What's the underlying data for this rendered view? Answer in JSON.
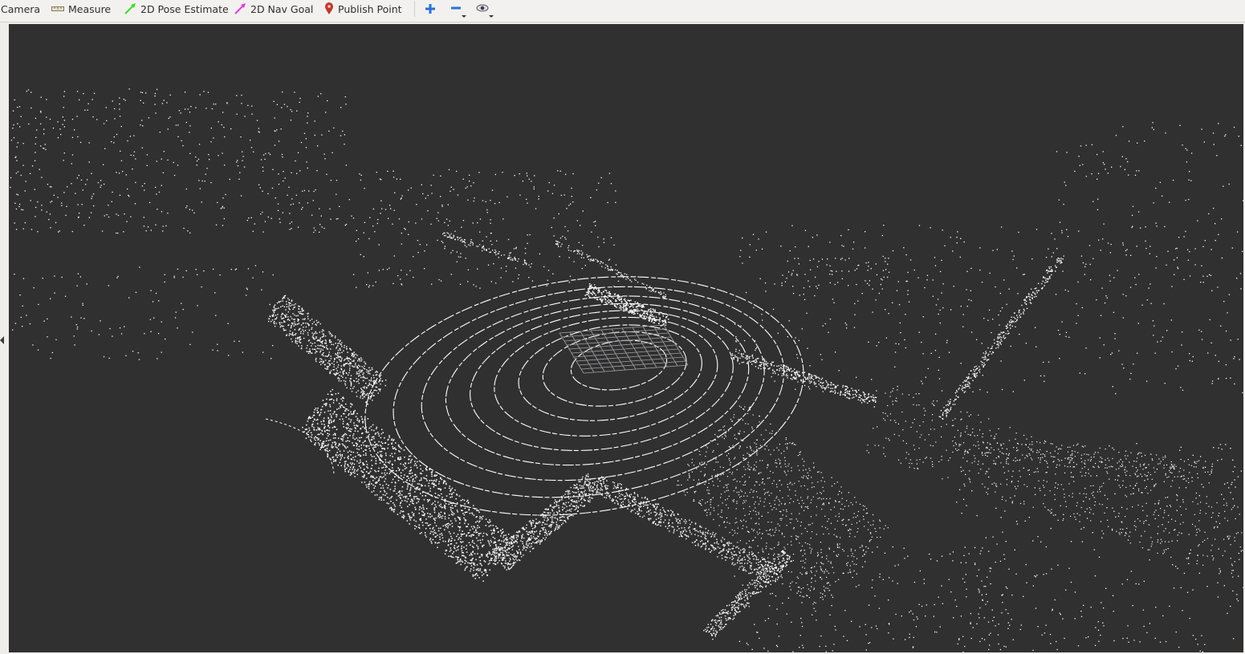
{
  "toolbar": {
    "camera_label": "Camera",
    "measure_label": "Measure",
    "pose_estimate_label": "2D Pose Estimate",
    "nav_goal_label": "2D Nav Goal",
    "publish_point_label": "Publish Point",
    "icons": {
      "measure": "ruler-icon",
      "pose_estimate": "green-arrow-icon",
      "nav_goal": "magenta-arrow-icon",
      "publish_point": "map-pin-icon",
      "add_tool": "plus-icon",
      "remove_tool": "minus-icon",
      "visibility": "eye-icon"
    }
  },
  "colors": {
    "viewport_background": "#303030",
    "points": "#ffffff",
    "grid": "#a0a0a4",
    "pose_estimate_icon": "#3ddc2f",
    "nav_goal_icon": "#e03fd8",
    "publish_point_icon": "#c0392b",
    "tool_icon_blue": "#2a6fd6"
  }
}
